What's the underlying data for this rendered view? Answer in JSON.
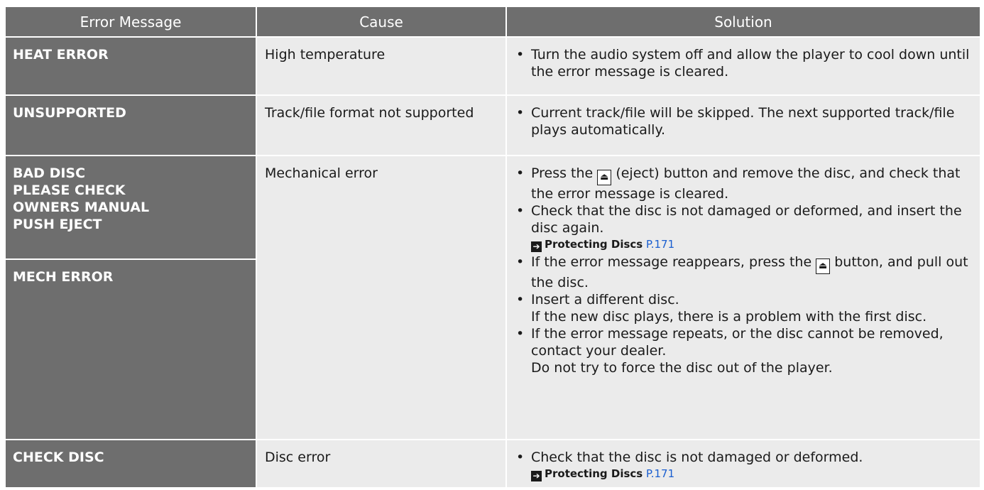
{
  "headers": {
    "error_message": "Error Message",
    "cause": "Cause",
    "solution": "Solution"
  },
  "rows": [
    {
      "error": [
        "HEAT ERROR"
      ],
      "cause": "High temperature",
      "solution_bullet": "•",
      "solution_text": "Turn the audio system off and allow the player to cool down until the error message is cleared."
    },
    {
      "error": [
        "UNSUPPORTED"
      ],
      "cause": "Track/file format not supported",
      "solution_bullet": "•",
      "solution_text": "Current track/file will be skipped. The next supported track/file plays automatically."
    },
    {
      "error": [
        "BAD DISC",
        "PLEASE CHECK",
        "OWNERS MANUAL",
        "PUSH EJECT"
      ],
      "cause": "Mechanical error"
    },
    {
      "error": [
        "MECH ERROR"
      ]
    },
    {
      "error": [
        "CHECK DISC"
      ],
      "cause": "Disc error",
      "solution_bullet": "•",
      "solution_text": "Check that the disc is not damaged or deformed."
    }
  ],
  "mechanical_solution": {
    "b1_pre": "Press the",
    "b1_post": "(eject) button and remove the disc, and check that the error message is cleared.",
    "b2": "Check that the disc is not damaged or deformed, and insert the disc again.",
    "b3_pre": "If the error message reappears, press the",
    "b3_post": "button, and pull out the disc.",
    "b4": "Insert a different disc.",
    "b4_cont": "If the new disc plays, there is a problem with the first disc.",
    "b5": "If the error message repeats, or the disc cannot be removed, contact your dealer.",
    "b5_cont": "Do not try to force the disc out of the player."
  },
  "reference": {
    "arrow": "➔",
    "title": "Protecting Discs",
    "page": "P.171"
  },
  "icons": {
    "bullet": "•",
    "eject_symbol": "⏏"
  },
  "colors": {
    "header_bg": "#6e6e6e",
    "cell_bg": "#ebebeb",
    "link": "#1a5fd0"
  }
}
